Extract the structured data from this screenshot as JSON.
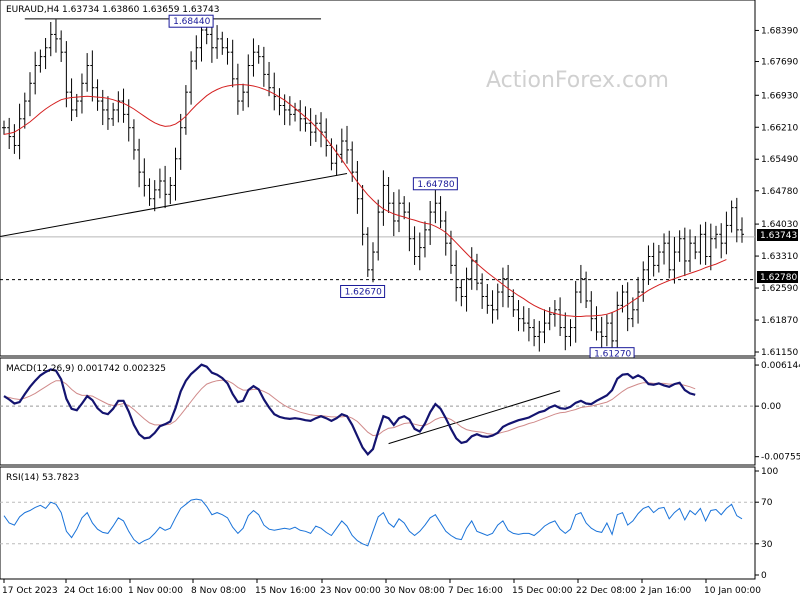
{
  "chart_data": {
    "type": "candlestick",
    "watermark": "ActionForex.com",
    "title": "EURAUD,H4  1.63734 1.63860 1.63659 1.63743",
    "x_ticks": [
      "17 Oct 2023",
      "24 Oct 16:00",
      "1 Nov 00:00",
      "8 Nov 08:00",
      "15 Nov 16:00",
      "23 Nov 00:00",
      "30 Nov 08:00",
      "7 Dec 16:00",
      "15 Dec 00:00",
      "22 Dec 08:00",
      "2 Jan 16:00",
      "10 Jan 00:00"
    ],
    "price": {
      "ylim": [
        1.6115,
        1.6885
      ],
      "y_ticks": [
        "1.68390",
        "1.67690",
        "1.66930",
        "1.66210",
        "1.65490",
        "1.64780",
        "1.64030",
        "1.63310",
        "1.62590",
        "1.61870",
        "1.61150"
      ],
      "current": "1.63743",
      "current_value": 1.63743,
      "level": "1.62780",
      "level_value": 1.6278,
      "annotations": [
        {
          "text": "1.68440",
          "index": 36,
          "value": 1.6844
        },
        {
          "text": "1.64780",
          "index": 83,
          "value": 1.6478
        },
        {
          "text": "1.62670",
          "index": 69,
          "value": 1.6267
        },
        {
          "text": "1.61270",
          "index": 117,
          "value": 1.6127
        }
      ],
      "trendline": {
        "from": [
          0,
          1.6375
        ],
        "to": [
          66,
          1.6517
        ]
      },
      "resistance": {
        "from": [
          4,
          1.6865
        ],
        "to": [
          61,
          1.6865
        ]
      },
      "closes": [
        1.662,
        1.66,
        1.658,
        1.664,
        1.668,
        1.672,
        1.676,
        1.678,
        1.68,
        1.683,
        1.682,
        1.679,
        1.67,
        1.666,
        1.668,
        1.672,
        1.676,
        1.671,
        1.668,
        1.666,
        1.664,
        1.666,
        1.668,
        1.665,
        1.662,
        1.657,
        1.652,
        1.649,
        1.646,
        1.648,
        1.65,
        1.647,
        1.649,
        1.655,
        1.662,
        1.67,
        1.677,
        1.68,
        1.684,
        1.683,
        1.68,
        1.682,
        1.68,
        1.679,
        1.673,
        1.668,
        1.67,
        1.676,
        1.679,
        1.678,
        1.674,
        1.671,
        1.669,
        1.667,
        1.666,
        1.665,
        1.666,
        1.664,
        1.663,
        1.661,
        1.663,
        1.661,
        1.658,
        1.654,
        1.656,
        1.659,
        1.657,
        1.652,
        1.646,
        1.638,
        1.63,
        1.634,
        1.643,
        1.649,
        1.645,
        1.641,
        1.645,
        1.643,
        1.637,
        1.633,
        1.635,
        1.639,
        1.643,
        1.645,
        1.641,
        1.636,
        1.631,
        1.626,
        1.624,
        1.628,
        1.632,
        1.627,
        1.624,
        1.622,
        1.621,
        1.625,
        1.628,
        1.624,
        1.621,
        1.619,
        1.618,
        1.617,
        1.615,
        1.616,
        1.618,
        1.62,
        1.621,
        1.617,
        1.615,
        1.617,
        1.625,
        1.628,
        1.623,
        1.619,
        1.616,
        1.615,
        1.618,
        1.614,
        1.622,
        1.625,
        1.619,
        1.621,
        1.625,
        1.63,
        1.633,
        1.631,
        1.634,
        1.636,
        1.63,
        1.634,
        1.637,
        1.632,
        1.636,
        1.634,
        1.638,
        1.633,
        1.637,
        1.638,
        1.636,
        1.64,
        1.644,
        1.639,
        1.638
      ],
      "ma": [
        1.6605,
        1.6607,
        1.661,
        1.6617,
        1.6625,
        1.6633,
        1.6643,
        1.6653,
        1.6662,
        1.667,
        1.6677,
        1.6683,
        1.6686,
        1.6688,
        1.6689,
        1.669,
        1.6691,
        1.669,
        1.6689,
        1.6688,
        1.6686,
        1.6683,
        1.6679,
        1.6675,
        1.6669,
        1.6662,
        1.6654,
        1.6646,
        1.6638,
        1.6631,
        1.6626,
        1.6623,
        1.6624,
        1.6628,
        1.6636,
        1.6646,
        1.6659,
        1.6671,
        1.6682,
        1.6692,
        1.67,
        1.6706,
        1.6711,
        1.6714,
        1.6716,
        1.6717,
        1.6717,
        1.6716,
        1.6714,
        1.6711,
        1.6707,
        1.6702,
        1.6696,
        1.6689,
        1.6682,
        1.6673,
        1.6664,
        1.6654,
        1.6644,
        1.6634,
        1.6622,
        1.6609,
        1.6595,
        1.658,
        1.6564,
        1.6548,
        1.6531,
        1.6514,
        1.6498,
        1.6483,
        1.6469,
        1.6457,
        1.6446,
        1.6437,
        1.6431,
        1.6426,
        1.6422,
        1.6419,
        1.6415,
        1.6412,
        1.6408,
        1.6405,
        1.6403,
        1.6398,
        1.6392,
        1.6384,
        1.6373,
        1.6361,
        1.6349,
        1.6337,
        1.6325,
        1.6314,
        1.6304,
        1.6294,
        1.6285,
        1.6276,
        1.6267,
        1.6258,
        1.625,
        1.6242,
        1.6235,
        1.6227,
        1.622,
        1.6214,
        1.6209,
        1.6205,
        1.6202,
        1.6199,
        1.6197,
        1.6196,
        1.6195,
        1.6195,
        1.6196,
        1.6196,
        1.6197,
        1.6198,
        1.62,
        1.6204,
        1.6209,
        1.6215,
        1.6222,
        1.623,
        1.6238,
        1.6246,
        1.6254,
        1.626,
        1.6266,
        1.6271,
        1.6276,
        1.628,
        1.6284,
        1.6288,
        1.6292,
        1.6296,
        1.63,
        1.6305,
        1.6309,
        1.6313,
        1.6318,
        1.6323
      ]
    },
    "macd": {
      "label": "MACD(12,26,9) 0.001742 0.002325",
      "ylim": [
        -0.0082,
        0.0066
      ],
      "y_ticks": [
        {
          "text": "0.006144",
          "value": 0.006144
        },
        {
          "text": "0.00",
          "value": 0
        },
        {
          "text": "-0.007555",
          "value": -0.007555
        }
      ],
      "trendline": {
        "from": [
          74,
          -0.0056
        ],
        "to": [
          107,
          0.0023
        ]
      },
      "main": [
        0.0015,
        0.001,
        0.0004,
        0.0006,
        0.0018,
        0.0029,
        0.0038,
        0.0046,
        0.0051,
        0.0055,
        0.0053,
        0.004,
        0.0011,
        -0.0004,
        -0.0006,
        0.0004,
        0.0015,
        0.0009,
        -0.0003,
        -0.001,
        -0.0012,
        -0.0004,
        0.0008,
        0.0008,
        -0.0008,
        -0.0028,
        -0.0042,
        -0.0048,
        -0.0047,
        -0.004,
        -0.003,
        -0.0027,
        -0.0023,
        -0.0003,
        0.0022,
        0.0038,
        0.0048,
        0.0055,
        0.0062,
        0.0059,
        0.005,
        0.0047,
        0.0042,
        0.0034,
        0.0018,
        0.0006,
        0.0008,
        0.0024,
        0.003,
        0.0025,
        0.001,
        -0.0002,
        -0.0012,
        -0.0016,
        -0.0018,
        -0.0019,
        -0.0018,
        -0.0019,
        -0.0021,
        -0.0022,
        -0.0018,
        -0.0015,
        -0.0018,
        -0.0022,
        -0.0018,
        -0.0012,
        -0.0015,
        -0.0028,
        -0.0045,
        -0.0062,
        -0.0072,
        -0.0064,
        -0.0038,
        -0.0015,
        -0.0018,
        -0.0028,
        -0.0018,
        -0.0015,
        -0.002,
        -0.0034,
        -0.0038,
        -0.0026,
        -0.0009,
        0.0003,
        -0.0004,
        -0.0018,
        -0.0034,
        -0.0048,
        -0.0055,
        -0.0053,
        -0.0045,
        -0.0042,
        -0.0045,
        -0.0046,
        -0.0044,
        -0.004,
        -0.0031,
        -0.0027,
        -0.0024,
        -0.0021,
        -0.0019,
        -0.0017,
        -0.0013,
        -0.0009,
        -0.0007,
        -0.0002,
        0.0001,
        -0.0003,
        -0.0004,
        -0.0001,
        0.0005,
        0.0008,
        0.0004,
        0.0003,
        0.0008,
        0.0012,
        0.0016,
        0.0024,
        0.0041,
        0.0047,
        0.0048,
        0.0042,
        0.0046,
        0.0042,
        0.0033,
        0.0032,
        0.0034,
        0.0031,
        0.0029,
        0.0033,
        0.0035,
        0.0024,
        0.0019,
        0.0017
      ],
      "signal": [
        0.0014,
        0.0013,
        0.0011,
        0.001,
        0.0012,
        0.0015,
        0.0019,
        0.0024,
        0.0029,
        0.0034,
        0.0038,
        0.0038,
        0.0033,
        0.0025,
        0.0019,
        0.0016,
        0.0016,
        0.0015,
        0.0011,
        0.0007,
        0.0003,
        0.0001,
        0.0002,
        0.0004,
        0.0001,
        -0.0005,
        -0.0012,
        -0.0019,
        -0.0025,
        -0.0028,
        -0.0028,
        -0.0028,
        -0.0027,
        -0.0022,
        -0.0013,
        -0.0003,
        0.0007,
        0.0017,
        0.0026,
        0.0033,
        0.0036,
        0.0038,
        0.0039,
        0.0038,
        0.0034,
        0.0028,
        0.0024,
        0.0024,
        0.0025,
        0.0025,
        0.0022,
        0.0018,
        0.0012,
        0.0006,
        0.0001,
        -0.0003,
        -0.0006,
        -0.0009,
        -0.0011,
        -0.0013,
        -0.0014,
        -0.0014,
        -0.0015,
        -0.0016,
        -0.0016,
        -0.0016,
        -0.0015,
        -0.0018,
        -0.0023,
        -0.0031,
        -0.0039,
        -0.0044,
        -0.0043,
        -0.0037,
        -0.0033,
        -0.0032,
        -0.0029,
        -0.0026,
        -0.0025,
        -0.0027,
        -0.0029,
        -0.0029,
        -0.0025,
        -0.002,
        -0.0017,
        -0.0017,
        -0.002,
        -0.0025,
        -0.0031,
        -0.0035,
        -0.0037,
        -0.0038,
        -0.0039,
        -0.0041,
        -0.0042,
        -0.0041,
        -0.0039,
        -0.0037,
        -0.0034,
        -0.0031,
        -0.0029,
        -0.0026,
        -0.0024,
        -0.0021,
        -0.0018,
        -0.0015,
        -0.0012,
        -0.001,
        -0.0009,
        -0.0007,
        -0.0005,
        -0.0002,
        -0.0001,
        0.0,
        0.0002,
        0.0004,
        0.0006,
        0.001,
        0.0016,
        0.0022,
        0.0027,
        0.003,
        0.0033,
        0.0035,
        0.0035,
        0.0034,
        0.0034,
        0.0034,
        0.0033,
        0.0033,
        0.0033,
        0.0031,
        0.0029,
        0.0026
      ]
    },
    "rsi": {
      "label": "RSI(14) 53.7823",
      "ylim": [
        0,
        100
      ],
      "y_ticks": [
        {
          "text": "100",
          "value": 100
        },
        {
          "text": "70",
          "value": 70
        },
        {
          "text": "30",
          "value": 30
        },
        {
          "text": "0",
          "value": 0
        }
      ],
      "levels": [
        70,
        30
      ],
      "values": [
        57,
        50,
        48,
        56,
        60,
        62,
        65,
        67,
        64,
        70,
        68,
        60,
        42,
        36,
        44,
        55,
        60,
        50,
        44,
        41,
        40,
        47,
        55,
        52,
        42,
        34,
        30,
        33,
        35,
        40,
        46,
        43,
        45,
        55,
        64,
        68,
        72,
        73,
        72,
        66,
        58,
        60,
        58,
        55,
        46,
        40,
        45,
        57,
        62,
        58,
        48,
        44,
        43,
        44,
        45,
        44,
        46,
        43,
        42,
        40,
        47,
        45,
        41,
        38,
        45,
        52,
        47,
        38,
        33,
        30,
        28,
        42,
        56,
        60,
        50,
        46,
        54,
        50,
        42,
        38,
        42,
        48,
        55,
        58,
        50,
        42,
        38,
        35,
        34,
        45,
        52,
        42,
        40,
        38,
        40,
        48,
        52,
        43,
        40,
        39,
        40,
        40,
        38,
        42,
        47,
        50,
        52,
        44,
        40,
        44,
        58,
        60,
        50,
        45,
        42,
        41,
        50,
        39,
        58,
        60,
        48,
        52,
        59,
        64,
        66,
        60,
        64,
        65,
        54,
        60,
        64,
        53,
        62,
        58,
        64,
        52,
        62,
        63,
        58,
        64,
        68,
        57,
        54
      ]
    }
  }
}
